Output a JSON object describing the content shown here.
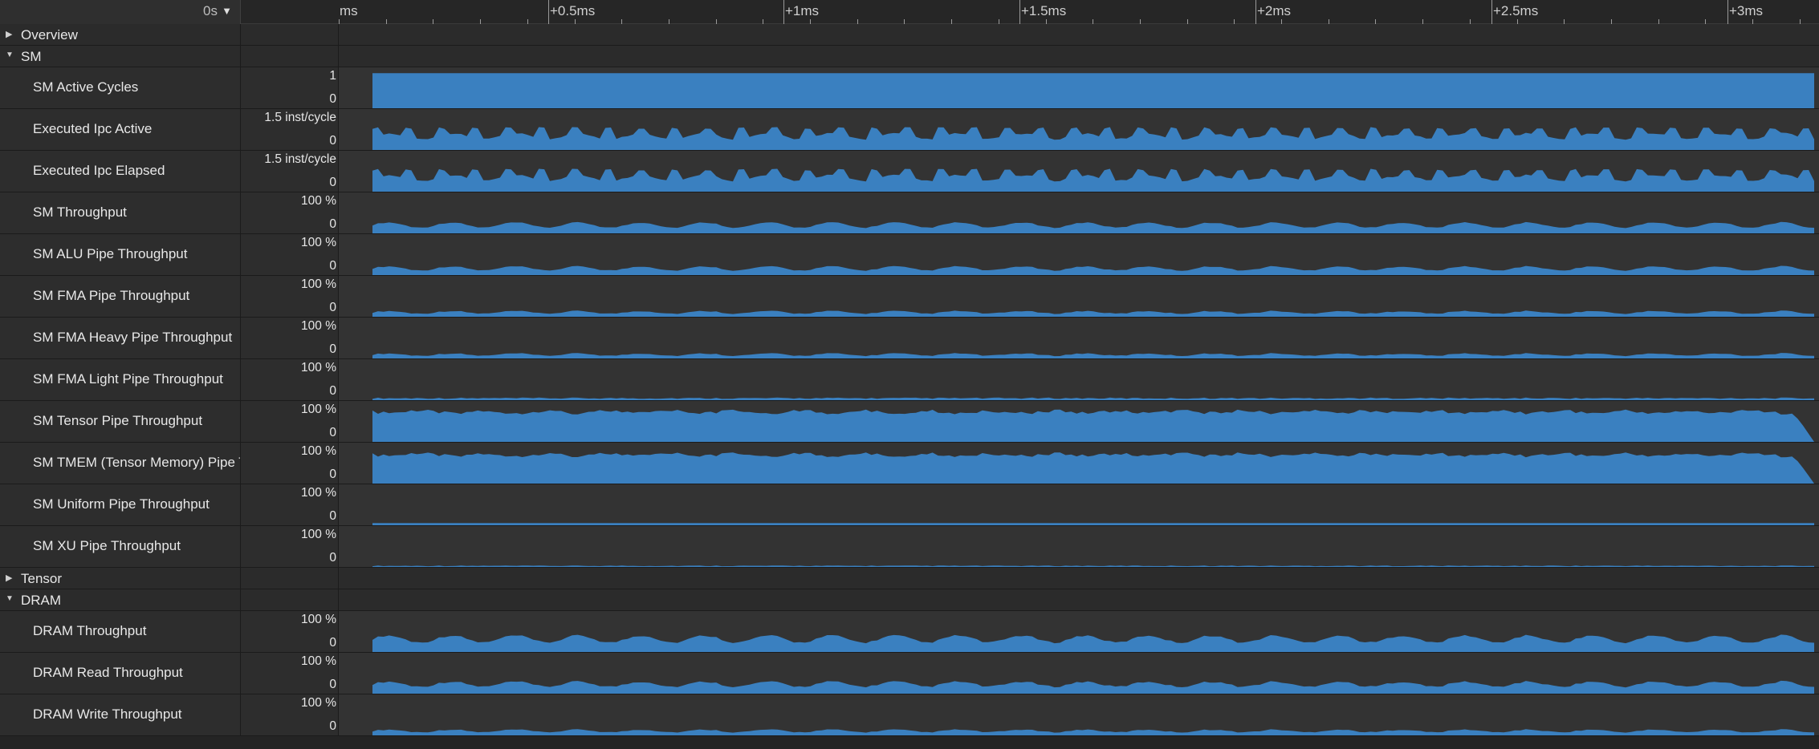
{
  "colors": {
    "series": "#3a80c0",
    "track_bg": "#333333",
    "page_bg": "#242424"
  },
  "header": {
    "time_select": "0s",
    "ruler_start": "ms",
    "ticks": [
      "+0.5ms",
      "+1ms",
      "+1.5ms",
      "+2ms",
      "+2.5ms",
      "+3ms"
    ]
  },
  "rows": [
    {
      "type": "section",
      "label": "Overview",
      "expanded": false
    },
    {
      "type": "section",
      "label": "SM",
      "expanded": true
    },
    {
      "type": "metric",
      "label": "SM Active Cycles",
      "max": "1",
      "min": "0",
      "profile": "solid",
      "level": 0.95
    },
    {
      "type": "metric",
      "label": "Executed Ipc Active",
      "max": "1.5 inst/cycle",
      "min": "0",
      "profile": "ipc",
      "level": 0.55
    },
    {
      "type": "metric",
      "label": "Executed Ipc Elapsed",
      "max": "1.5 inst/cycle",
      "min": "0",
      "profile": "ipc",
      "level": 0.55
    },
    {
      "type": "metric",
      "label": "SM Throughput",
      "max": "100 %",
      "min": "0",
      "profile": "low",
      "level": 0.28
    },
    {
      "type": "metric",
      "label": "SM ALU Pipe Throughput",
      "max": "100 %",
      "min": "0",
      "profile": "low",
      "level": 0.22
    },
    {
      "type": "metric",
      "label": "SM FMA Pipe Throughput",
      "max": "100 %",
      "min": "0",
      "profile": "low",
      "level": 0.14
    },
    {
      "type": "metric",
      "label": "SM FMA Heavy Pipe Throughput",
      "max": "100 %",
      "min": "0",
      "profile": "low",
      "level": 0.12
    },
    {
      "type": "metric",
      "label": "SM FMA Light Pipe Throughput",
      "max": "100 %",
      "min": "0",
      "profile": "tiny",
      "level": 0.07
    },
    {
      "type": "metric",
      "label": "SM Tensor Pipe Throughput",
      "max": "100 %",
      "min": "0",
      "profile": "high",
      "level": 0.88
    },
    {
      "type": "metric",
      "label": "SM TMEM (Tensor Memory) Pipe Throughput",
      "max": "100 %",
      "min": "0",
      "profile": "high",
      "level": 0.85
    },
    {
      "type": "metric",
      "label": "SM Uniform Pipe Throughput",
      "max": "100 %",
      "min": "0",
      "profile": "flat",
      "level": 0.06
    },
    {
      "type": "metric",
      "label": "SM XU Pipe Throughput",
      "max": "100 %",
      "min": "0",
      "profile": "tiny",
      "level": 0.04
    },
    {
      "type": "section",
      "label": "Tensor",
      "expanded": false
    },
    {
      "type": "section",
      "label": "DRAM",
      "expanded": true
    },
    {
      "type": "metric",
      "label": "DRAM Throughput",
      "max": "100 %",
      "min": "0",
      "profile": "dram",
      "level": 0.42
    },
    {
      "type": "metric",
      "label": "DRAM Read Throughput",
      "max": "100 %",
      "min": "0",
      "profile": "dram",
      "level": 0.3
    },
    {
      "type": "metric",
      "label": "DRAM Write Throughput",
      "max": "100 %",
      "min": "0",
      "profile": "low",
      "level": 0.14
    }
  ]
}
